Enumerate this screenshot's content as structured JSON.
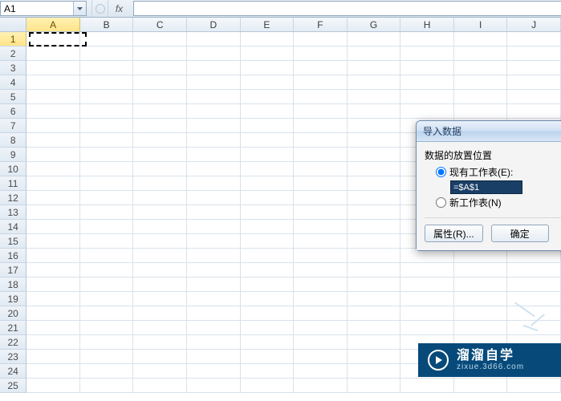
{
  "namebox": {
    "value": "A1"
  },
  "fx_label": "fx",
  "formula": {
    "value": ""
  },
  "columns": [
    "A",
    "B",
    "C",
    "D",
    "E",
    "F",
    "G",
    "H",
    "I",
    "J"
  ],
  "selected_col_index": 0,
  "row_count": 25,
  "selected_row": 1,
  "dialog": {
    "title": "导入数据",
    "section_label": "数据的放置位置",
    "radio_existing": "现有工作表(E):",
    "existing_value": "=$A$1",
    "radio_new": "新工作表(N)",
    "selected": "existing",
    "btn_props": "属性(R)...",
    "btn_ok": "确定"
  },
  "watermark": {
    "brand": "溜溜自学",
    "url": "zixue.3d66.com"
  }
}
